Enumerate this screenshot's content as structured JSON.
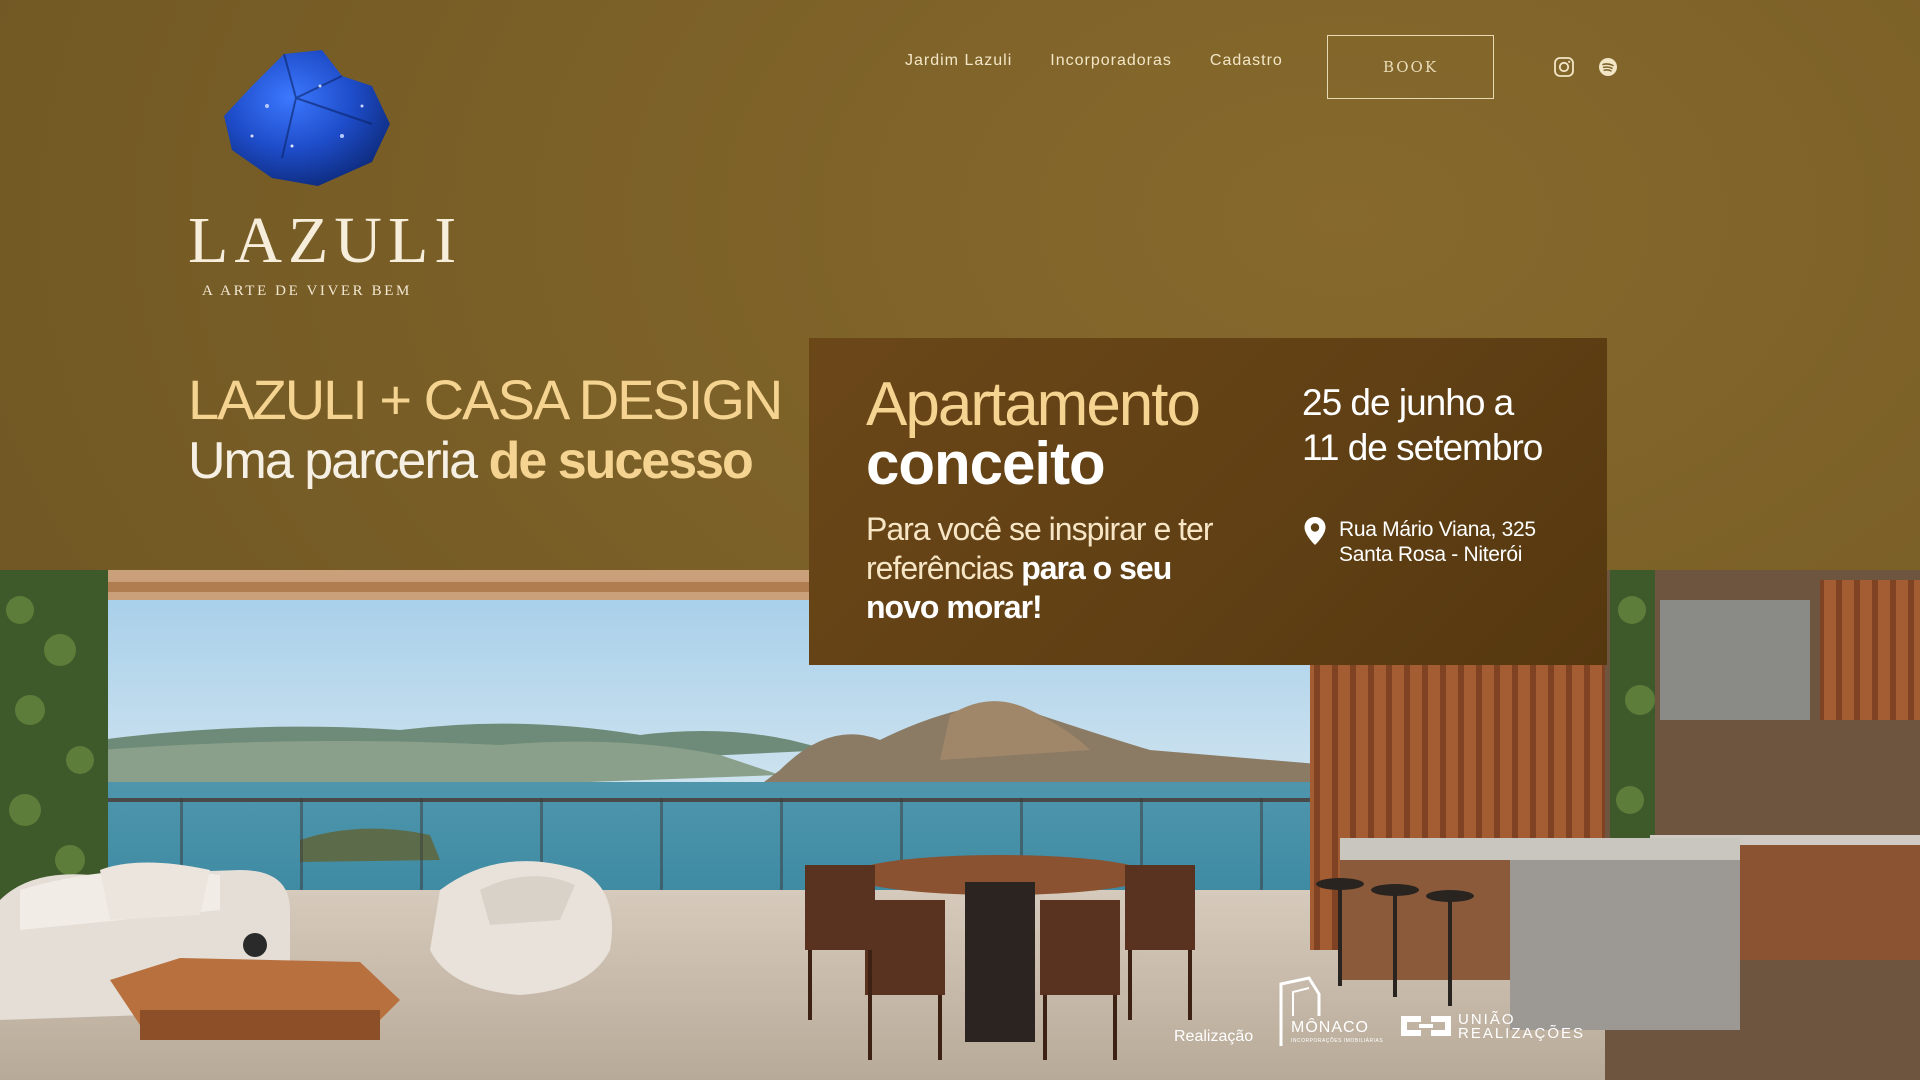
{
  "nav": {
    "items": [
      "Jardim Lazuli",
      "Incorporadoras",
      "Cadastro"
    ],
    "book_label": "BOOK",
    "social_icons": [
      "instagram-icon",
      "spotify-icon"
    ]
  },
  "logo": {
    "brand": "LAZULI",
    "tagline": "A ARTE DE VIVER BEM"
  },
  "headline": {
    "line1": "LAZULI + CASA DESIGN",
    "line2_regular": "Uma parceria ",
    "line2_bold": "de sucesso"
  },
  "panel": {
    "title_line1": "Apartamento",
    "title_line2": "conceito",
    "body_regular": "Para você se inspirar e ter referências ",
    "body_bold": "para o seu novo morar!",
    "dates_line1": "25 de junho a",
    "dates_line2": "11 de setembro",
    "address_line1": "Rua Mário Viana, 325",
    "address_line2": "Santa Rosa - Niterói"
  },
  "credits": {
    "label": "Realização",
    "monaco_name": "MÔNACO",
    "monaco_sub": "INCORPORAÇÕES IMOBILIÁRIAS",
    "uniao_line1": "UNIÃO",
    "uniao_line2": "REALIZAÇÕES"
  },
  "colors": {
    "background": "#7a6128",
    "panel": "#5f3f14",
    "accent_gold": "#f5d391",
    "lapis_blue": "#1f4fc4"
  }
}
